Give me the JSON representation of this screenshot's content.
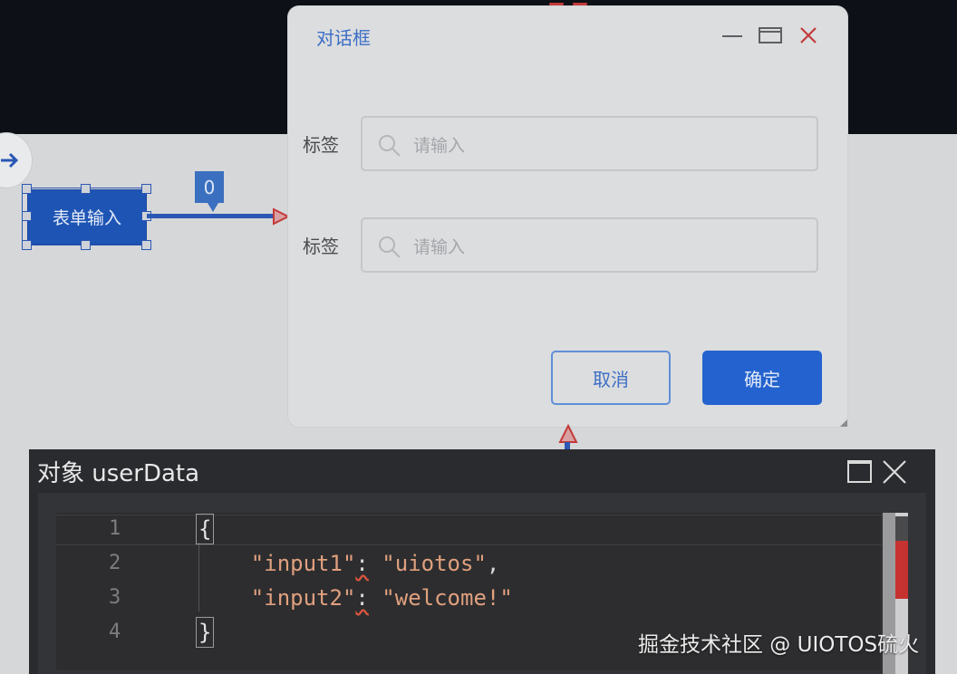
{
  "canvas": {
    "node_label": "表单输入",
    "link_count": "0"
  },
  "dialog": {
    "title": "对话框",
    "fields": [
      {
        "label": "标签",
        "placeholder": "请输入"
      },
      {
        "label": "标签",
        "placeholder": "请输入"
      }
    ],
    "cancel_label": "取消",
    "ok_label": "确定"
  },
  "panel": {
    "title": "对象 userData",
    "code_lines": [
      {
        "num": "1",
        "text": "{"
      },
      {
        "num": "2",
        "key": "\"input1\"",
        "colon": ":",
        "value": "\"uiotos\"",
        "comma": ","
      },
      {
        "num": "3",
        "key": "\"input2\"",
        "colon": ":",
        "value": "\"welcome!\""
      },
      {
        "num": "4",
        "text": "}"
      }
    ]
  },
  "watermark": "掘金技术社区 @ UIOTOS硫火",
  "colors": {
    "accent": "#2463cf",
    "panel_bg": "#2a2b2e",
    "error": "#c6322f"
  }
}
